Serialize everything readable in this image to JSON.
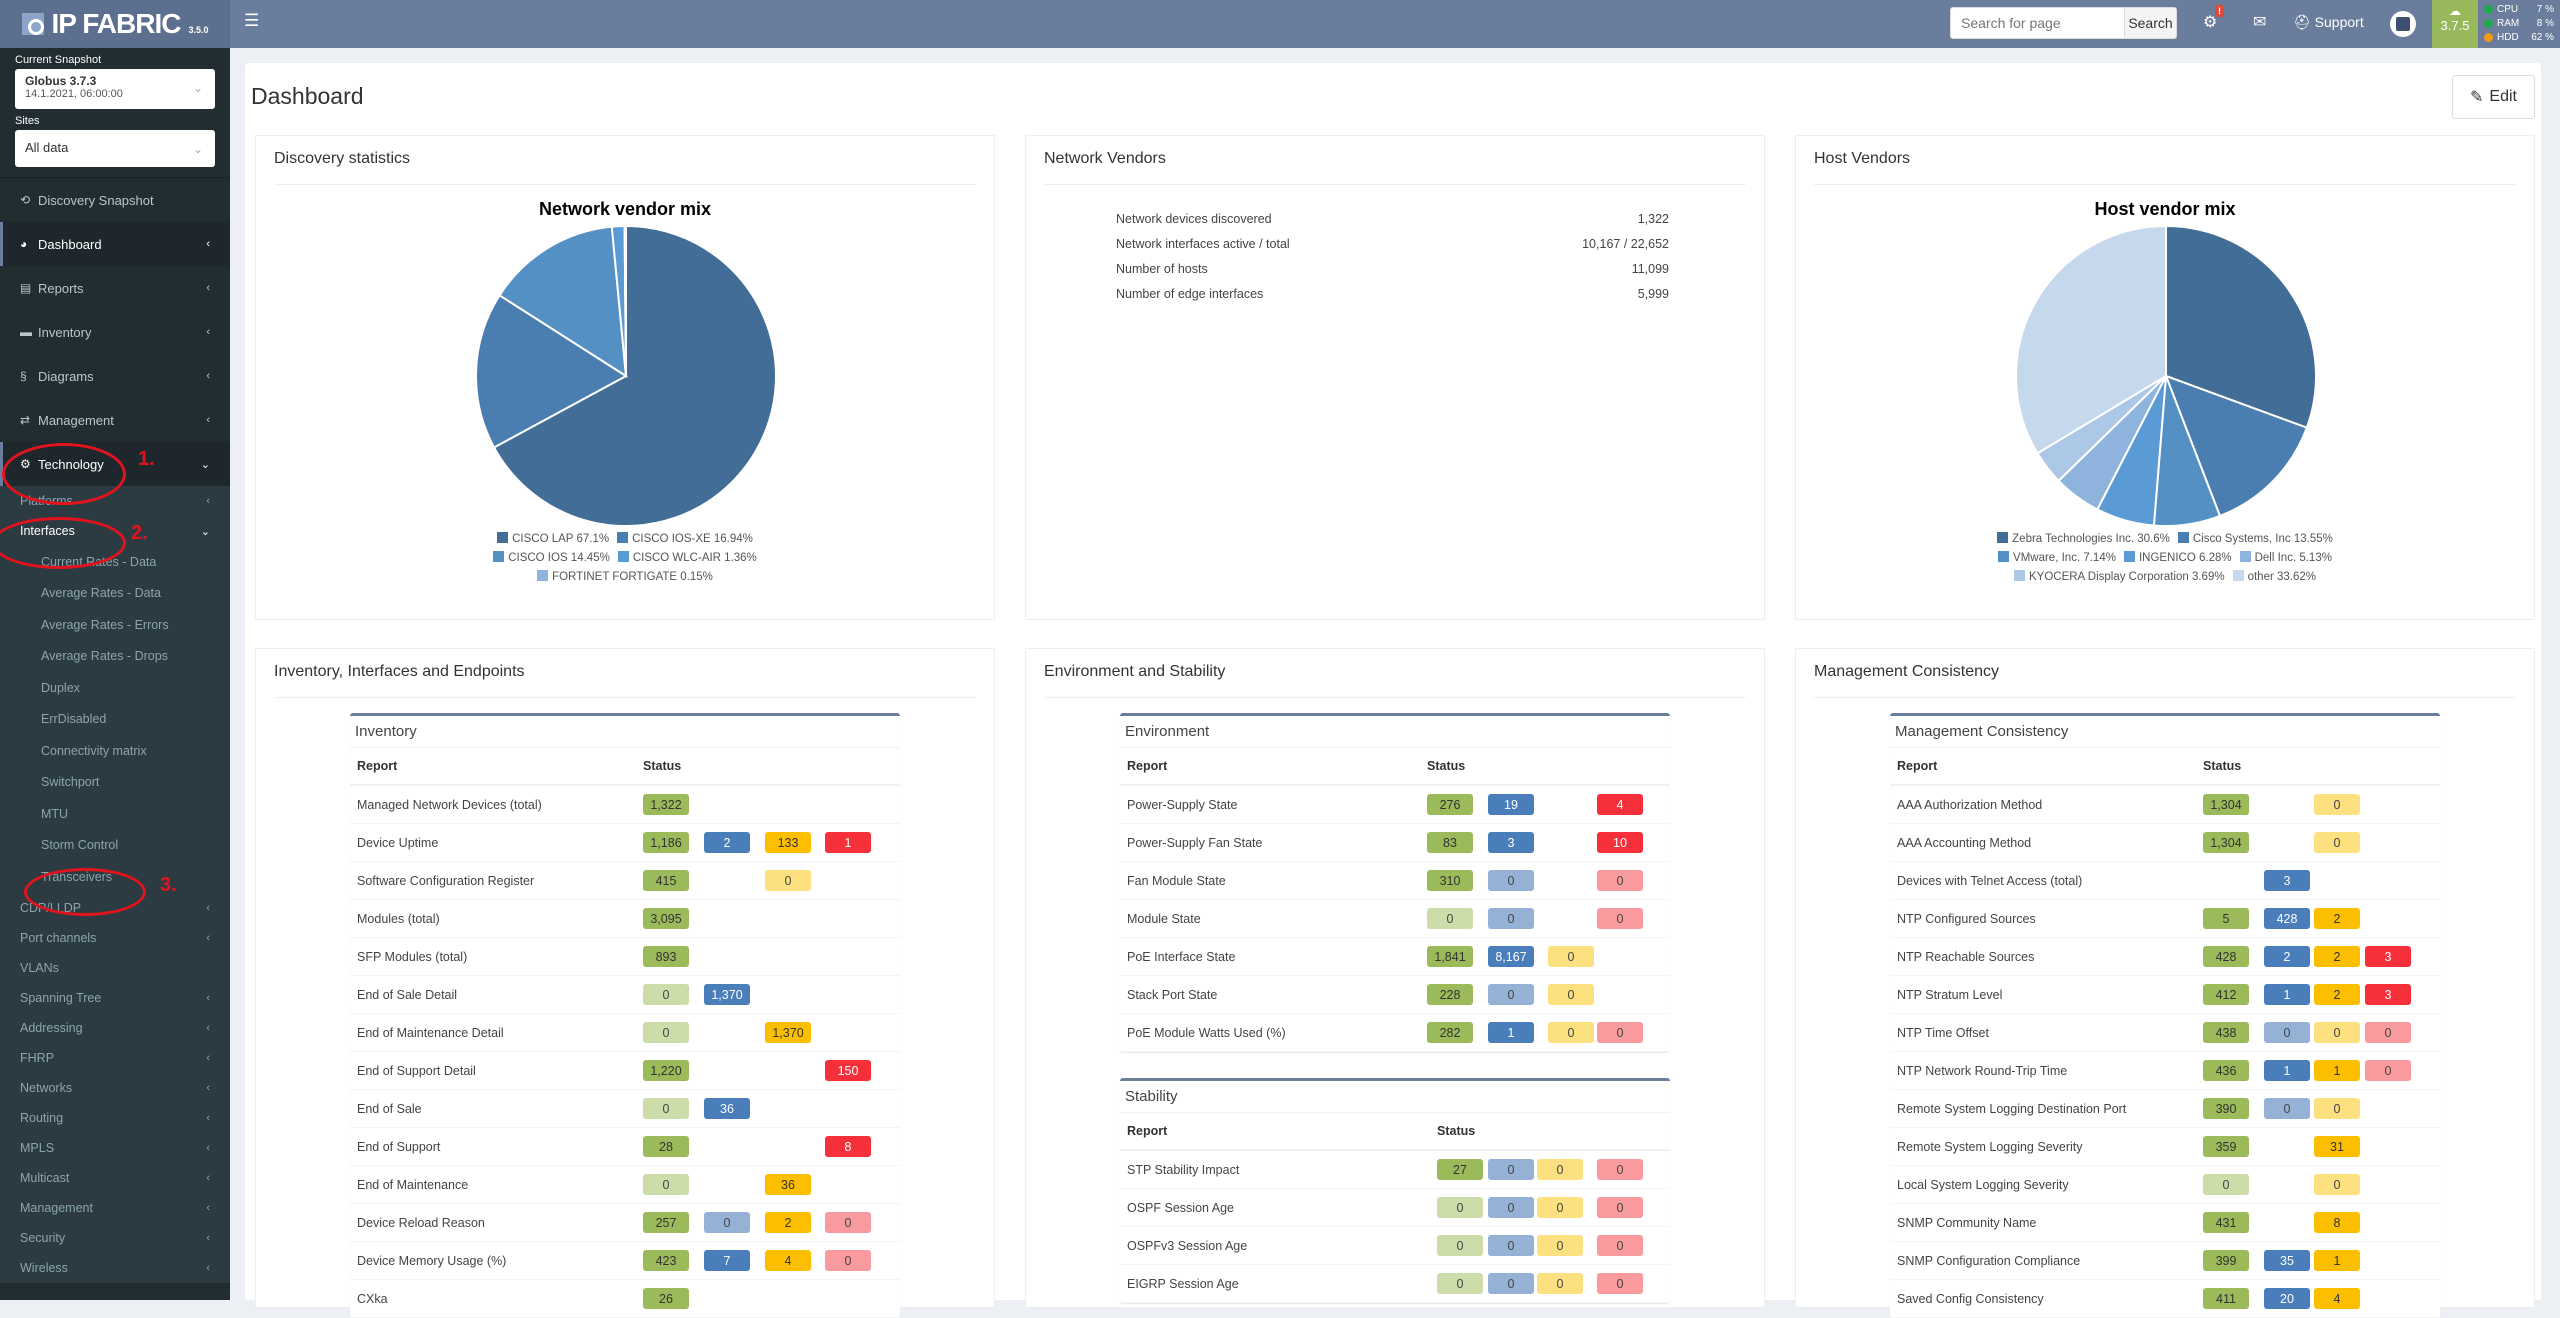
{
  "app": {
    "name": "IP FABRIC",
    "version": "3.5.0"
  },
  "topbar": {
    "search_placeholder": "Search for page",
    "search_button": "Search",
    "alert_badge": "!",
    "support_label": "Support",
    "update_version": "3.7.5",
    "resources": [
      {
        "label": "CPU",
        "value": "7 %",
        "color": "#1fa94b"
      },
      {
        "label": "RAM",
        "value": "8 %",
        "color": "#1fa94b"
      },
      {
        "label": "HDD",
        "value": "62 %",
        "color": "#f39c12"
      }
    ]
  },
  "sidebar": {
    "snapshot_label": "Current Snapshot",
    "snapshot_name": "Globus 3.7.3",
    "snapshot_date": "14.1.2021, 06:00:00",
    "sites_label": "Sites",
    "sites_value": "All data",
    "items": [
      {
        "label": "Discovery Snapshot",
        "icon": "history-icon",
        "glyph": "⟲"
      },
      {
        "label": "Dashboard",
        "icon": "dashboard-icon",
        "glyph": "◕",
        "arrow": "‹"
      },
      {
        "label": "Reports",
        "icon": "file-icon",
        "glyph": "▤",
        "arrow": "‹"
      },
      {
        "label": "Inventory",
        "icon": "archive-icon",
        "glyph": "▬",
        "arrow": "‹"
      },
      {
        "label": "Diagrams",
        "icon": "diagram-icon",
        "glyph": "§",
        "arrow": "‹"
      },
      {
        "label": "Management",
        "icon": "exchange-icon",
        "glyph": "⇄",
        "arrow": "‹"
      },
      {
        "label": "Technology",
        "icon": "cogs-icon",
        "glyph": "⚙",
        "arrow": "⌄"
      }
    ],
    "technology_sub": [
      {
        "label": "Platforms",
        "arrow": "‹"
      },
      {
        "label": "Interfaces",
        "arrow": "⌄"
      }
    ],
    "interfaces_sub": [
      "Current Rates - Data",
      "Average Rates - Data",
      "Average Rates - Errors",
      "Average Rates - Drops",
      "Duplex",
      "ErrDisabled",
      "Connectivity matrix",
      "Switchport",
      "MTU",
      "Storm Control",
      "Transceivers"
    ],
    "technology_more": [
      {
        "label": "CDP/LLDP",
        "arrow": "‹"
      },
      {
        "label": "Port channels",
        "arrow": "‹"
      },
      {
        "label": "VLANs",
        "arrow": ""
      },
      {
        "label": "Spanning Tree",
        "arrow": "‹"
      },
      {
        "label": "Addressing",
        "arrow": "‹"
      },
      {
        "label": "FHRP",
        "arrow": "‹"
      },
      {
        "label": "Networks",
        "arrow": "‹"
      },
      {
        "label": "Routing",
        "arrow": "‹"
      },
      {
        "label": "MPLS",
        "arrow": "‹"
      },
      {
        "label": "Multicast",
        "arrow": "‹"
      },
      {
        "label": "Management",
        "arrow": "‹"
      },
      {
        "label": "Security",
        "arrow": "‹"
      },
      {
        "label": "Wireless",
        "arrow": "‹"
      }
    ],
    "annotations": [
      "1.",
      "2.",
      "3."
    ]
  },
  "page": {
    "title": "Dashboard",
    "edit_label": "Edit"
  },
  "panels": {
    "discovery": {
      "title": "Discovery statistics"
    },
    "network_vendors": {
      "title": "Network Vendors",
      "stats": [
        {
          "label": "Network devices discovered",
          "value": "1,322"
        },
        {
          "label": "Network interfaces active / total",
          "value": "10,167 / 22,652"
        },
        {
          "label": "Number of hosts",
          "value": "11,099"
        },
        {
          "label": "Number of edge interfaces",
          "value": "5,999"
        }
      ]
    },
    "host_vendors": {
      "title": "Host Vendors"
    },
    "inventory_section": {
      "title": "Inventory, Interfaces and Endpoints"
    },
    "environment_section": {
      "title": "Environment and Stability"
    },
    "management_section": {
      "title": "Management Consistency"
    }
  },
  "chart_data": [
    {
      "type": "pie",
      "title": "Network vendor mix",
      "categories": [
        "CISCO LAP",
        "CISCO IOS-XE",
        "CISCO IOS",
        "CISCO WLC-AIR",
        "FORTINET FORTIGATE"
      ],
      "values": [
        67.1,
        16.94,
        14.45,
        1.36,
        0.15
      ],
      "colors": [
        "#416d96",
        "#4a7eb0",
        "#5590c4",
        "#5b9bd5",
        "#8eb4dd"
      ],
      "legend_rows": [
        [
          0,
          1
        ],
        [
          2,
          3
        ],
        [
          4
        ]
      ],
      "legend": "bottom"
    },
    {
      "type": "pie",
      "title": "Host vendor mix",
      "categories": [
        "Zebra Technologies Inc.",
        "Cisco Systems, Inc",
        "VMware, Inc.",
        "INGENICO",
        "Dell Inc.",
        "KYOCERA Display Corporation",
        "other"
      ],
      "values": [
        30.6,
        13.55,
        7.14,
        6.28,
        5.13,
        3.69,
        33.62
      ],
      "colors": [
        "#416d96",
        "#4a7eb0",
        "#5590c4",
        "#5b9bd5",
        "#8eb4dd",
        "#adc8e6",
        "#c6d8ec"
      ],
      "legend_rows": [
        [
          0,
          1
        ],
        [
          2,
          3,
          4
        ],
        [
          5,
          6
        ]
      ],
      "legend": "bottom"
    }
  ],
  "tables": {
    "inventory": {
      "title": "Inventory",
      "col_report": "Report",
      "col_status": "Status",
      "rows": [
        {
          "report": "Managed Network Devices (total)",
          "cells": [
            [
              "1,322",
              "g"
            ],
            null,
            null,
            null
          ]
        },
        {
          "report": "Device Uptime",
          "cells": [
            [
              "1,186",
              "g"
            ],
            [
              "2",
              "b"
            ],
            [
              "133",
              "y"
            ],
            [
              "1",
              "r"
            ]
          ]
        },
        {
          "report": "Software Configuration Register",
          "cells": [
            [
              "415",
              "g"
            ],
            null,
            [
              "0",
              "y0"
            ],
            null
          ]
        },
        {
          "report": "Modules (total)",
          "cells": [
            [
              "3,095",
              "g"
            ],
            null,
            null,
            null
          ]
        },
        {
          "report": "SFP Modules (total)",
          "cells": [
            [
              "893",
              "g"
            ],
            null,
            null,
            null
          ]
        },
        {
          "report": "End of Sale Detail",
          "cells": [
            [
              "0",
              "g0"
            ],
            [
              "1,370",
              "b"
            ],
            null,
            null
          ]
        },
        {
          "report": "End of Maintenance Detail",
          "cells": [
            [
              "0",
              "g0"
            ],
            null,
            [
              "1,370",
              "y"
            ],
            null
          ]
        },
        {
          "report": "End of Support Detail",
          "cells": [
            [
              "1,220",
              "g"
            ],
            null,
            null,
            [
              "150",
              "r"
            ]
          ]
        },
        {
          "report": "End of Sale",
          "cells": [
            [
              "0",
              "g0"
            ],
            [
              "36",
              "b"
            ],
            null,
            null
          ]
        },
        {
          "report": "End of Support",
          "cells": [
            [
              "28",
              "g"
            ],
            null,
            null,
            [
              "8",
              "r"
            ]
          ]
        },
        {
          "report": "End of Maintenance",
          "cells": [
            [
              "0",
              "g0"
            ],
            null,
            [
              "36",
              "y"
            ],
            null
          ]
        },
        {
          "report": "Device Reload Reason",
          "cells": [
            [
              "257",
              "g"
            ],
            [
              "0",
              "b0"
            ],
            [
              "2",
              "y"
            ],
            [
              "0",
              "r0"
            ]
          ]
        },
        {
          "report": "Device Memory Usage (%)",
          "cells": [
            [
              "423",
              "g"
            ],
            [
              "7",
              "b"
            ],
            [
              "4",
              "y"
            ],
            [
              "0",
              "r0"
            ]
          ]
        },
        {
          "report": "CXka",
          "cells": [
            [
              "26",
              "g"
            ],
            null,
            null,
            null
          ]
        }
      ]
    },
    "environment": {
      "title": "Environment",
      "col_report": "Report",
      "col_status": "Status",
      "rows": [
        {
          "report": "Power-Supply State",
          "cells": [
            [
              "276",
              "g"
            ],
            [
              "19",
              "b"
            ],
            null,
            [
              "4",
              "r"
            ]
          ]
        },
        {
          "report": "Power-Supply Fan State",
          "cells": [
            [
              "83",
              "g"
            ],
            [
              "3",
              "b"
            ],
            null,
            [
              "10",
              "r"
            ]
          ]
        },
        {
          "report": "Fan Module State",
          "cells": [
            [
              "310",
              "g"
            ],
            [
              "0",
              "b0"
            ],
            null,
            [
              "0",
              "r0"
            ]
          ]
        },
        {
          "report": "Module State",
          "cells": [
            [
              "0",
              "g0"
            ],
            [
              "0",
              "b0"
            ],
            null,
            [
              "0",
              "r0"
            ]
          ]
        },
        {
          "report": "PoE Interface State",
          "cells": [
            [
              "1,841",
              "g"
            ],
            [
              "8,167",
              "b"
            ],
            [
              "0",
              "y0"
            ],
            null
          ]
        },
        {
          "report": "Stack Port State",
          "cells": [
            [
              "228",
              "g"
            ],
            [
              "0",
              "b0"
            ],
            [
              "0",
              "y0"
            ],
            null
          ]
        },
        {
          "report": "PoE Module Watts Used (%)",
          "cells": [
            [
              "282",
              "g"
            ],
            [
              "1",
              "b"
            ],
            [
              "0",
              "y0"
            ],
            [
              "0",
              "r0"
            ]
          ]
        }
      ]
    },
    "stability": {
      "title": "Stability",
      "col_report": "Report",
      "col_status": "Status",
      "rows": [
        {
          "report": "STP Stability Impact",
          "cells": [
            [
              "27",
              "g"
            ],
            [
              "0",
              "b0"
            ],
            [
              "0",
              "y0"
            ],
            [
              "0",
              "r0"
            ]
          ]
        },
        {
          "report": "OSPF Session Age",
          "cells": [
            [
              "0",
              "g0"
            ],
            [
              "0",
              "b0"
            ],
            [
              "0",
              "y0"
            ],
            [
              "0",
              "r0"
            ]
          ]
        },
        {
          "report": "OSPFv3 Session Age",
          "cells": [
            [
              "0",
              "g0"
            ],
            [
              "0",
              "b0"
            ],
            [
              "0",
              "y0"
            ],
            [
              "0",
              "r0"
            ]
          ]
        },
        {
          "report": "EIGRP Session Age",
          "cells": [
            [
              "0",
              "g0"
            ],
            [
              "0",
              "b0"
            ],
            [
              "0",
              "y0"
            ],
            [
              "0",
              "r0"
            ]
          ]
        }
      ]
    },
    "management": {
      "title": "Management Consistency",
      "col_report": "Report",
      "col_status": "Status",
      "rows": [
        {
          "report": "AAA Authorization Method",
          "cells": [
            [
              "1,304",
              "g"
            ],
            null,
            [
              "0",
              "y0"
            ],
            null
          ]
        },
        {
          "report": "AAA Accounting Method",
          "cells": [
            [
              "1,304",
              "g"
            ],
            null,
            [
              "0",
              "y0"
            ],
            null
          ]
        },
        {
          "report": "Devices with Telnet Access (total)",
          "cells": [
            null,
            [
              "3",
              "b"
            ],
            null,
            null
          ]
        },
        {
          "report": "NTP Configured Sources",
          "cells": [
            [
              "5",
              "g"
            ],
            [
              "428",
              "b"
            ],
            [
              "2",
              "y"
            ],
            null
          ]
        },
        {
          "report": "NTP Reachable Sources",
          "cells": [
            [
              "428",
              "g"
            ],
            [
              "2",
              "b"
            ],
            [
              "2",
              "y"
            ],
            [
              "3",
              "r"
            ]
          ]
        },
        {
          "report": "NTP Stratum Level",
          "cells": [
            [
              "412",
              "g"
            ],
            [
              "1",
              "b"
            ],
            [
              "2",
              "y"
            ],
            [
              "3",
              "r"
            ]
          ]
        },
        {
          "report": "NTP Time Offset",
          "cells": [
            [
              "438",
              "g"
            ],
            [
              "0",
              "b0"
            ],
            [
              "0",
              "y0"
            ],
            [
              "0",
              "r0"
            ]
          ]
        },
        {
          "report": "NTP Network Round-Trip Time",
          "cells": [
            [
              "436",
              "g"
            ],
            [
              "1",
              "b"
            ],
            [
              "1",
              "y"
            ],
            [
              "0",
              "r0"
            ]
          ]
        },
        {
          "report": "Remote System Logging Destination Port",
          "cells": [
            [
              "390",
              "g"
            ],
            [
              "0",
              "b0"
            ],
            [
              "0",
              "y0"
            ],
            null
          ]
        },
        {
          "report": "Remote System Logging Severity",
          "cells": [
            [
              "359",
              "g"
            ],
            null,
            [
              "31",
              "y"
            ],
            null
          ]
        },
        {
          "report": "Local System Logging Severity",
          "cells": [
            [
              "0",
              "g0"
            ],
            null,
            [
              "0",
              "y0"
            ],
            null
          ]
        },
        {
          "report": "SNMP Community Name",
          "cells": [
            [
              "431",
              "g"
            ],
            null,
            [
              "8",
              "y"
            ],
            null
          ]
        },
        {
          "report": "SNMP Configuration Compliance",
          "cells": [
            [
              "399",
              "g"
            ],
            [
              "35",
              "b"
            ],
            [
              "1",
              "y"
            ],
            null
          ]
        },
        {
          "report": "Saved Config Consistency",
          "cells": [
            [
              "411",
              "g"
            ],
            [
              "20",
              "b"
            ],
            [
              "4",
              "y"
            ],
            null
          ]
        }
      ]
    }
  }
}
